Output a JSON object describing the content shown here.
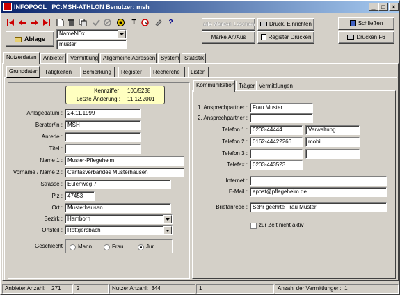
{
  "window": {
    "app_name": "INFOPOOL",
    "title_rest": "PC:MSH-ATHLON Benutzer: msh",
    "controls": [
      "_",
      "□",
      "×"
    ]
  },
  "toolbar": {
    "icons": [
      "first-icon",
      "prev-icon",
      "next-icon",
      "last-icon",
      "new-icon",
      "delete-icon",
      "copy-icon",
      "check-icon",
      "cancel-icon",
      "target-icon",
      "text-icon",
      "clock-icon",
      "stamp-icon",
      "help-icon"
    ],
    "help_glyph": "?",
    "text_glyph": "T",
    "ablage_label": "Ablage",
    "sort_select": "NameNDx",
    "search_value": "muster",
    "alle_marken_label": "alle Marken Löschen",
    "marke_label": "Marke An/Aus",
    "druck_einrichten_label": "Druck. Einrichten",
    "register_drucken_label": "Register Drucken",
    "schliessen_label": "Schließen",
    "drucken_f6_label": "Drucken F6"
  },
  "main_tabs": [
    "Nutzerdaten",
    "Anbieter",
    "Vermittlung",
    "Allgemeine Adressen",
    "System",
    "Statistik"
  ],
  "sub_tabs": [
    "Grunddaten",
    "Tätigkeiten",
    "Bemerkung",
    "Register",
    "Recherche",
    "Listen"
  ],
  "info_box": {
    "kennziffer_label": "Kennziffer",
    "kennziffer_value": "100/5238",
    "aenderung_label": "Letzte Änderung :",
    "aenderung_value": "11.12.2001"
  },
  "left_form": {
    "anlagedatum_label": "Anlagedatum :",
    "anlagedatum": "24.11.1999",
    "berater_label": "Berater/in :",
    "berater": "MSH",
    "anrede_label": "Anrede :",
    "anrede": "",
    "titel_label": "Titel :",
    "titel": "",
    "name1_label": "Name 1 :",
    "name1": "Muster-Pflegeheim",
    "name2_label": "Vorname / Name 2 :",
    "name2": "Caritasverbandes Musterhausen",
    "strasse_label": "Strasse :",
    "strasse": "Eulenweg 7",
    "plz_label": "Plz :",
    "plz": "47453",
    "ort_label": "Ort :",
    "ort": "Musterhausen",
    "bezirk_label": "Bezirk :",
    "bezirk": "Hamborn",
    "ortsteil_label": "Ortsteil :",
    "ortsteil": "Röttgersbach",
    "geschlecht_label": "Geschlecht",
    "geschlecht_options": [
      "Mann",
      "Frau",
      "Jur."
    ],
    "geschlecht_selected": "Jur."
  },
  "right_tabs": [
    "Kommunikation",
    "Träger",
    "Vermittlungen"
  ],
  "right_form": {
    "ap1_label": "1. Ansprechpartner :",
    "ap1": "Frau Muster",
    "ap2_label": "2. Ansprechpartner :",
    "ap2": "",
    "tel1_label": "Telefon 1 :",
    "tel1": "0203-44444",
    "tel1_note": "Verwaltung",
    "tel2_label": "Telefon 2 :",
    "tel2": "0162-44422266",
    "tel2_note": "mobil",
    "tel3_label": "Telefon 3 :",
    "tel3": "",
    "tel3_note": "",
    "telefax_label": "Telefax :",
    "telefax": "0203-443523",
    "internet_label": "Internet :",
    "internet": "",
    "email_label": "E-Mail :",
    "email": "epost@pflegeheim.de",
    "briefanrede_label": "Briefanrede :",
    "briefanrede": "Sehr geehrte Frau Muster",
    "inaktiv_label": "zur Zeit nicht aktiv"
  },
  "statusbar": {
    "anbieter_label": "Anbieter Anzahl:",
    "anbieter_count": "271",
    "field2": "2",
    "nutzer_label": "Nutzer Anzahl:",
    "nutzer_count": "344",
    "field4": "1",
    "vermittlungen_label": "Anzahl der Vermittlungen:",
    "vermittlungen_count": "1"
  },
  "colors": {
    "face": "#d4d0c8",
    "title_start": "#0a246a",
    "info_bg": "#ffffc0",
    "arrow_red": "#cc0000"
  }
}
